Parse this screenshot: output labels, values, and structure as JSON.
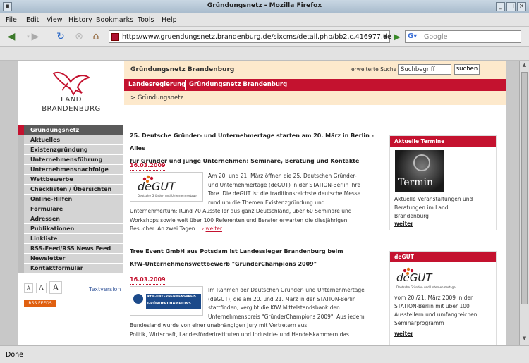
{
  "window": {
    "title": "Gründungsnetz - Mozilla Firefox"
  },
  "menu": [
    "File",
    "Edit",
    "View",
    "History",
    "Bookmarks",
    "Tools",
    "Help"
  ],
  "toolbar": {
    "url": "http://www.gruendungsnetz.brandenburg.de/sixcms/detail.php/bb2.c.416977.de",
    "search_placeholder": "Google"
  },
  "status": "Done",
  "site": {
    "logo_line1": "LAND",
    "logo_line2": "BRANDENBURG",
    "header_title": "Gründungsnetz Brandenburg",
    "search_label": "erweiterte Suche",
    "search_value": "Suchbegriff",
    "search_button": "suchen",
    "top_nav": [
      "Landesregierung",
      "Gründungsnetz Brandenburg"
    ],
    "breadcrumb": "> Gründungsnetz"
  },
  "nav": [
    "Gründungsnetz",
    "Aktuelles",
    "Existenzgründung",
    "Unternehmensführung",
    "Unternehmensnachfolge",
    "Wettbewerbe",
    "Checklisten / Übersichten",
    "Online-Hilfen",
    "Formulare",
    "Adressen",
    "Publikationen",
    "Linkliste",
    "RSS-Feed/RSS News Feed",
    "Newsletter",
    "Kontaktformular"
  ],
  "font_sizes": [
    "A",
    "A",
    "A"
  ],
  "textversion": "Textversion",
  "rss_badge": "RSS FEEDS",
  "articles": [
    {
      "title_l1": "25. Deutsche Gründer- und Unternehmertage starten am 20. März in Berlin - Alles",
      "title_l2": "für Gründer und junge Unternehmen: Seminare, Beratung und Kontakte",
      "date": "16.03.2009",
      "img_big": "deGUT",
      "img_small": "Deutsche Gründer- und Unternehmertage",
      "text": [
        "Am 20. und 21. März öffnen die 25. Deutschen Gründer-",
        "und Unternehmertage (deGUT) in der STATION-Berlin ihre",
        "Tore. Die deGUT ist die traditionsreichste deutsche Messe",
        "rund um die Themen Existenzgründung und",
        "Unternehmertum: Rund 70 Aussteller aus ganz Deutschland, über 60 Seminare und",
        "Workshops sowie weit über 100 Referenten und Berater erwarten die diesjährigen",
        "Besucher. An zwei Tagen..."
      ],
      "more": "weiter"
    },
    {
      "title_l1": "Tree Event GmbH aus Potsdam ist Landessieger Brandenburg beim",
      "title_l2": "KfW-Unternehmenswettbewerb \"GründerChampions 2009\"",
      "date": "16.03.2009",
      "img_big": "KfW-UNTERNEHMENSPREIS",
      "img_small": "GRÜNDERCHAMPIONS",
      "text": [
        "Im Rahmen der Deutschen Gründer- und Unternehmertage",
        "(deGUT), die am 20. und 21. März in der STATION-Berlin",
        "stattfinden, vergibt die KfW Mittelstandsbank den",
        "Unternehmenspreis \"GründerChampions 2009\". Aus jedem",
        "Bundesland wurde von einer unabhängigen Jury mit Vertretern aus",
        "Politik, Wirtschaft, Landesförderinstituten und Industrie- und Handelskammern das"
      ]
    }
  ],
  "sidebar": {
    "box1": {
      "header": "Aktuelle Termine",
      "img_label": "Termin",
      "text": [
        "Aktuelle Veranstaltungen und",
        "Beratungen im Land",
        "Brandenburg"
      ],
      "more": "weiter"
    },
    "box2": {
      "header": "deGUT",
      "img_big": "deGUT",
      "img_small": "Deutsche Gründer- und Unternehmertage",
      "text": [
        "vom 20./21. März 2009 in der",
        "STATION-Berlin mit über 100",
        "Ausstellern und umfangreichen",
        "Seminarprogramm"
      ],
      "more": "weiter"
    }
  },
  "colors": {
    "accent": "#c4122f",
    "header_bg": "#fde9cc",
    "nav_bg": "#d4d4d4",
    "nav_active": "#5a5a5a"
  }
}
